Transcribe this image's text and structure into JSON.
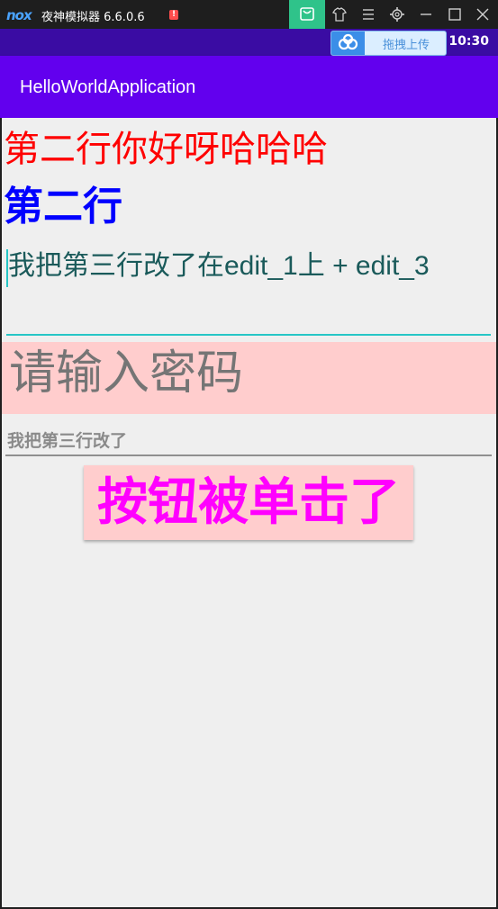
{
  "emulator": {
    "logo": "nox",
    "title": "夜神模拟器 6.6.0.6",
    "warning_badge": "!",
    "icons": [
      "store-bag-icon",
      "shirt-icon",
      "menu-icon",
      "gear-icon",
      "minimize-icon",
      "maximize-icon",
      "close-icon"
    ],
    "accent_color": "#2fc38a"
  },
  "status_bar": {
    "upload_label": "拖拽上传",
    "time": "10:30"
  },
  "app_bar": {
    "title": "HelloWorldApplication",
    "color": "#6200ee"
  },
  "content": {
    "text_red": "第二行你好呀哈哈哈",
    "text_blue": "第二行",
    "edit_1_text": "我把第三行改了在edit_1上 + edit_3",
    "password_hint": "请输入密码",
    "edit_3_text": "我把第三行改了",
    "button_label": "按钮被单击了"
  }
}
